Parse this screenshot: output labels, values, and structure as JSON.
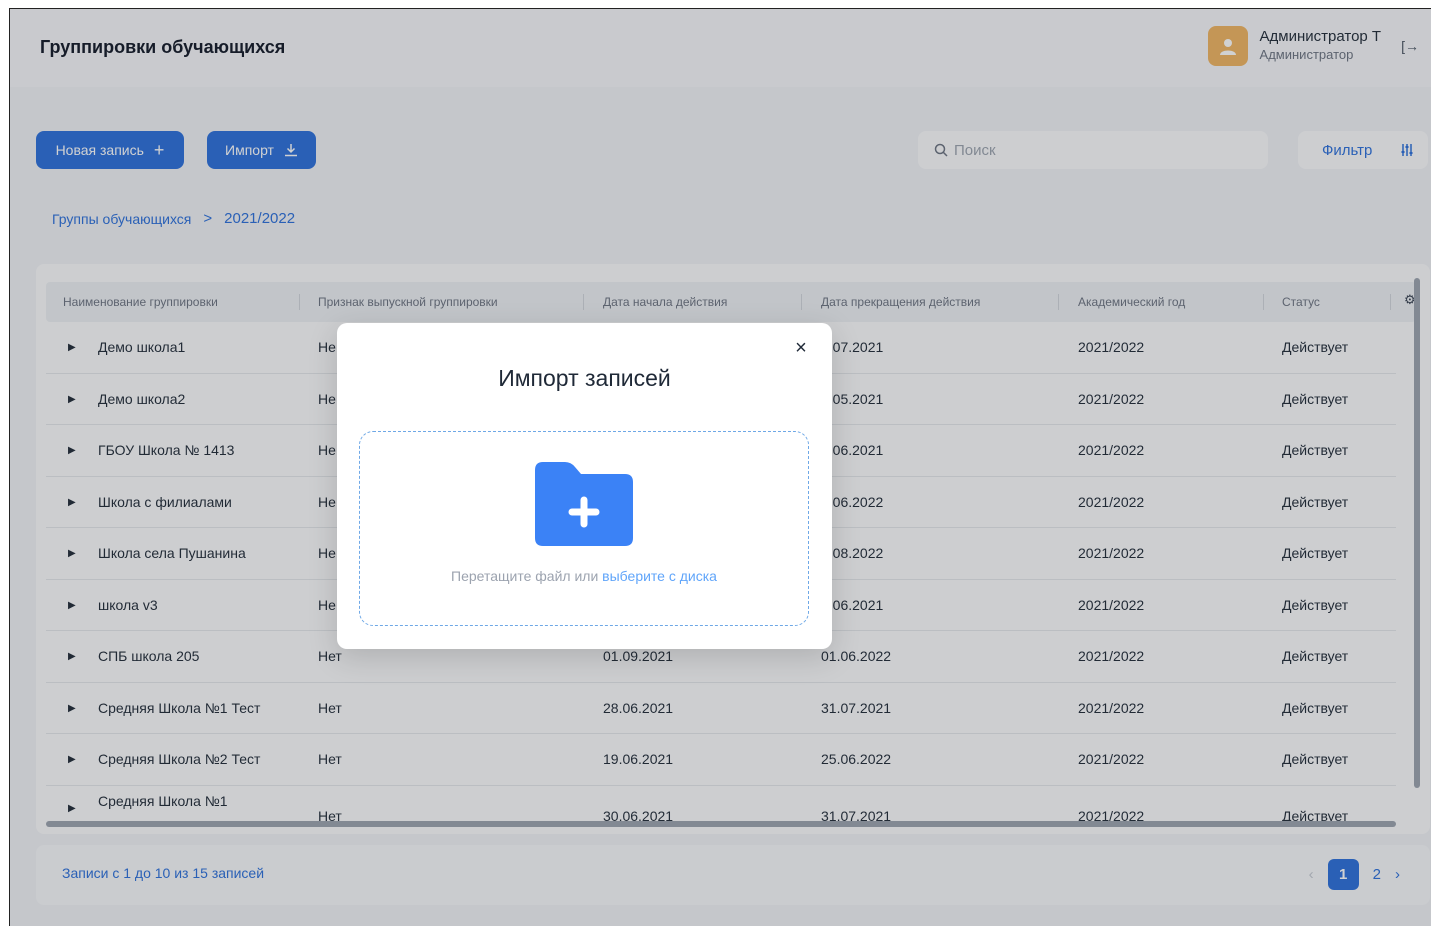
{
  "header": {
    "title": "Группировки обучающихся",
    "user_name": "Администратор Т",
    "user_role": "Администратор",
    "logout_icon": "logout-icon"
  },
  "toolbar": {
    "new_label": "Новая запись",
    "import_label": "Импорт",
    "search_placeholder": "Поиск",
    "filter_label": "Фильтр"
  },
  "breadcrumb": {
    "parent": "Группы обучающихся",
    "separator": ">",
    "current": "2021/2022"
  },
  "table": {
    "columns": [
      "Наименование группировки",
      "Признак выпускной группировки",
      "Дата начала действия",
      "Дата прекращения действия",
      "Академический год",
      "Статус"
    ],
    "rows": [
      {
        "name": "Демо школа1",
        "graduate": "Не",
        "start": "",
        "end": "0.07.2021",
        "year": "2021/2022",
        "status": "Действует"
      },
      {
        "name": "Демо школа2",
        "graduate": "Не",
        "start": "",
        "end": "5.05.2021",
        "year": "2021/2022",
        "status": "Действует"
      },
      {
        "name": "ГБОУ Школа № 1413",
        "graduate": "Не",
        "start": "",
        "end": "0.06.2021",
        "year": "2021/2022",
        "status": "Действует"
      },
      {
        "name": "Школа с филиалами",
        "graduate": "Не",
        "start": "",
        "end": "1.06.2022",
        "year": "2021/2022",
        "status": "Действует"
      },
      {
        "name": "Школа села Пушанина",
        "graduate": "Не",
        "start": "",
        "end": "5.08.2022",
        "year": "2021/2022",
        "status": "Действует"
      },
      {
        "name": "школа v3",
        "graduate": "Не",
        "start": "",
        "end": "6.06.2021",
        "year": "2021/2022",
        "status": "Действует"
      },
      {
        "name": "СПБ школа 205",
        "graduate": "Нет",
        "start": "01.09.2021",
        "end": "01.06.2022",
        "year": "2021/2022",
        "status": "Действует"
      },
      {
        "name": "Средняя Школа №1 Тест",
        "graduate": "Нет",
        "start": "28.06.2021",
        "end": "31.07.2021",
        "year": "2021/2022",
        "status": "Действует"
      },
      {
        "name": "Средняя Школа №2 Тест",
        "graduate": "Нет",
        "start": "19.06.2021",
        "end": "25.06.2022",
        "year": "2021/2022",
        "status": "Действует"
      },
      {
        "name": "Средняя Школа №1",
        "graduate": "Нет",
        "start": "30.06.2021",
        "end": "31.07.2021",
        "year": "2021/2022",
        "status": "Действует"
      }
    ]
  },
  "footer": {
    "records_text": "Записи с 1 до 10 из 15 записей",
    "prev": "‹",
    "pages": [
      "1",
      "2"
    ],
    "next": "›"
  },
  "modal": {
    "title": "Импорт записей",
    "close": "×",
    "drop_text": "Перетащите файл или ",
    "drop_link": "выберите с диска",
    "folder_icon": "folder-plus-icon"
  },
  "colors": {
    "accent": "#2b6fdc",
    "link": "#60a5fa",
    "avatar": "#f0b460"
  }
}
